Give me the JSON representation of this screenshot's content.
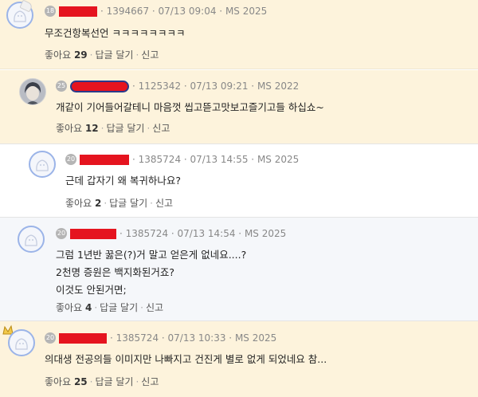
{
  "comments": [
    {
      "level": "18",
      "meta": "· 1394667 · 07/13 09:04 · MS 2025",
      "lines": [
        "무조건항복선언 ㅋㅋㅋㅋㅋㅋㅋㅋ"
      ],
      "like_label": "좋아요",
      "like_count": "29",
      "reply_label": "답글 달기",
      "report_label": "신고"
    },
    {
      "level": "25",
      "meta": "· 1125342 · 07/13 09:21 · MS 2022",
      "lines": [
        "개같이 기어들어갈테니 마음껏 씹고뜯고맛보고즐기고들 하십쇼~"
      ],
      "like_label": "좋아요",
      "like_count": "12",
      "reply_label": "답글 달기",
      "report_label": "신고"
    },
    {
      "level": "20",
      "meta": "· 1385724 · 07/13 14:55 · MS 2025",
      "lines": [
        "근데 갑자기 왜 복귀하나요?"
      ],
      "like_label": "좋아요",
      "like_count": "2",
      "reply_label": "답글 달기",
      "report_label": "신고"
    },
    {
      "level": "20",
      "meta": "· 1385724 · 07/13 14:54 · MS 2025",
      "lines": [
        "그럼 1년반 꿇은(?)거 말고 얻은게 없네요....?",
        "2천명 증원은 백지화된거죠?",
        "이것도 안된거면;"
      ],
      "like_label": "좋아요",
      "like_count": "4",
      "reply_label": "답글 달기",
      "report_label": "신고"
    },
    {
      "level": "20",
      "meta": "· 1385724 · 07/13 10:33 · MS 2025",
      "lines": [
        "의대생 전공의들 이미지만 나빠지고 건진게 별로 없게 되었네요 참..."
      ],
      "like_label": "좋아요",
      "like_count": "25",
      "reply_label": "답글 달기",
      "report_label": "신고"
    }
  ],
  "colors": {
    "highlight_bg": "#fdf3dc",
    "reply_bg": "#f5f7fa",
    "redaction": "#e5141f",
    "avatar_border": "#9bb4e8"
  },
  "icons": [
    "ghost-avatar-icon",
    "profile-photo-avatar",
    "crown-icon",
    "hat-icon"
  ]
}
